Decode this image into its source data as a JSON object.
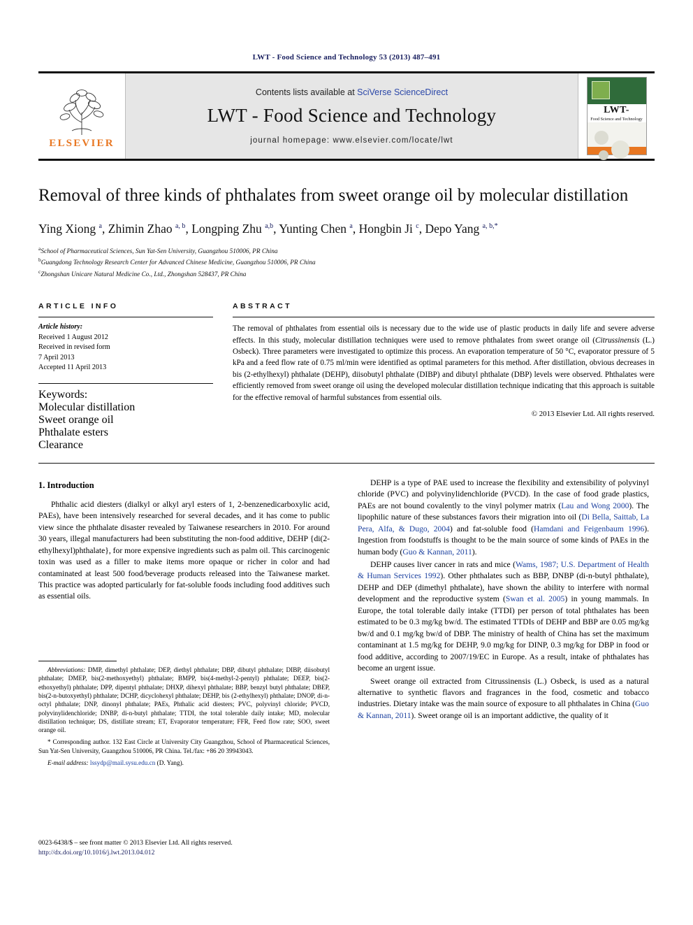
{
  "running_head": "LWT - Food Science and Technology 53 (2013) 487–491",
  "masthead": {
    "publisher_name": "ELSEVIER",
    "contents_prefix": "Contents lists available at ",
    "contents_link": "SciVerse ScienceDirect",
    "journal_name": "LWT - Food Science and Technology",
    "homepage": "journal homepage: www.elsevier.com/locate/lwt",
    "cover": {
      "title_big": "LWT-",
      "title_small": "Food Science and Technology"
    }
  },
  "article": {
    "title": "Removal of three kinds of phthalates from sweet orange oil by molecular distillation",
    "authors_html": "Ying Xiong <sup>a</sup>, Zhimin Zhao <sup>a, b</sup>, Longping Zhu <sup>a,b</sup>, Yunting Chen <sup>a</sup>, Hongbin Ji <sup>c</sup>, Depo Yang <sup>a, b,<span style=\"font-style:normal\">*</span></sup>",
    "affiliations": [
      "School of Pharmaceutical Sciences, Sun Yat-Sen University, Guangzhou 510006, PR China",
      "Guangdong Technology Research Center for Advanced Chinese Medicine, Guangzhou 510006, PR China",
      "Zhongshan Unicare Natural Medicine Co., Ltd., Zhongshan 528437, PR China"
    ],
    "affiliation_marks": [
      "a",
      "b",
      "c"
    ]
  },
  "article_info": {
    "heading": "ARTICLE INFO",
    "history_label": "Article history:",
    "history": [
      "Received 1 August 2012",
      "Received in revised form",
      "7 April 2013",
      "Accepted 11 April 2013"
    ],
    "keywords_label": "Keywords:",
    "keywords": [
      "Molecular distillation",
      "Sweet orange oil",
      "Phthalate esters",
      "Clearance"
    ]
  },
  "abstract": {
    "heading": "ABSTRACT",
    "text_part1": "The removal of phthalates from essential oils is necessary due to the wide use of plastic products in daily life and severe adverse effects. In this study, molecular distillation techniques were used to remove phthalates from sweet orange oil (",
    "species": "Citrussinensis",
    "text_part2": " (L.) Osbeck). Three parameters were investigated to optimize this process. An evaporation temperature of 50 °C, evaporator pressure of 5 kPa and a feed flow rate of 0.75 ml/min were identified as optimal parameters for this method. After distillation, obvious decreases in bis (2-ethylhexyl) phthalate (DEHP), diisobutyl phthalate (DIBP) and dibutyl phthalate (DBP) levels were observed. Phthalates were efficiently removed from sweet orange oil using the developed molecular distillation technique indicating that this approach is suitable for the effective removal of harmful substances from essential oils.",
    "copyright": "© 2013 Elsevier Ltd. All rights reserved."
  },
  "introduction": {
    "heading": "1.  Introduction",
    "p1": "Phthalic acid diesters (dialkyl or alkyl aryl esters of 1, 2-benzenedicarboxylic acid, PAEs), have been intensively researched for several decades, and it has come to public view since the phthalate disaster revealed by Taiwanese researchers in 2010. For around 30 years, illegal manufacturers had been substituting the non-food additive, DEHP {di(2-ethylhexyl)phthalate}, for more expensive ingredients such as palm oil. This carcinogenic toxin was used as a filler to make items more opaque or richer in color and had contaminated at least 500 food/beverage products released into the Taiwanese market. This practice was adopted particularly for fat-soluble foods including food additives such as essential oils."
  },
  "right_column": {
    "p1_a": "DEHP is a type of PAE used to increase the flexibility and extensibility of polyvinyl chloride (PVC) and polyvinylidenchloride (PVCD). In the case of food grade plastics, PAEs are not bound covalently to the vinyl polymer matrix (",
    "p1_cite1": "Lau and Wong 2000",
    "p1_b": "). The lipophilic nature of these substances favors their migration into oil (",
    "p1_cite2": "Di Bella, Saittab, La Pera, Alfa, & Dugo, 2004",
    "p1_c": ") and fat-soluble food (",
    "p1_cite3": "Hamdani and Feigenbaum 1996",
    "p1_d": "). Ingestion from foodstuffs is thought to be the main source of some kinds of PAEs in the human body (",
    "p1_cite4": "Guo & Kannan, 2011",
    "p1_e": ").",
    "p2_a": "DEHP causes liver cancer in rats and mice (",
    "p2_cite1": "Wams, 1987; U.S. Department of Health & Human Services 1992",
    "p2_b": "). Other phthalates such as BBP, DNBP (di-n-butyl phthalate), DEHP and DEP (dimethyl phthalate), have shown the ability to interfere with normal development and the reproductive system (",
    "p2_cite2": "Swan et al. 2005",
    "p2_c": ") in young mammals. In Europe, the total tolerable daily intake (TTDI) per person of total phthalates has been estimated to be 0.3 mg/kg bw/d. The estimated TTDIs of DEHP and BBP are 0.05 mg/kg bw/d and 0.1 mg/kg bw/d of DBP. The ministry of health of China has set the maximum contaminant at 1.5 mg/kg for DEHP, 9.0 mg/kg for DINP, 0.3 mg/kg for DBP in food or food additive, according to 2007/19/EC in Europe. As a result, intake of phthalates has become an urgent issue.",
    "p3_a": "Sweet orange oil extracted from ",
    "p3_species": "Citrussinensis",
    "p3_b": " (L.) Osbeck, is used as a natural alternative to synthetic flavors and fragrances in the food, cosmetic and tobacco industries. Dietary intake was the main source of exposure to all phthalates in China (",
    "p3_cite1": "Guo & Kannan, 2011",
    "p3_c": "). Sweet orange oil is an important addictive, the quality of it"
  },
  "footnotes": {
    "abbreviations_label": "Abbreviations:",
    "abbreviations_text": " DMP, dimethyl phthalate; DEP, diethyl phthalate; DBP, dibutyl phthalate; DIBP, diisobutyl phthalate; DMEP, bis(2-methoxyethyl) phthalate; BMPP, bis(4-methyl-2-pentyl) phthalate; DEEP, bis(2-ethoxyethyl) phthalate; DPP, dipentyl phthalate; DHXP, dihexyl phthalate; BBP, benzyl butyl phthalate; DBEP, bis(2-n-butoxyethyl) phthalate; DCHP, dicyclohexyl phthalate; DEHP, bis (2-ethylhexyl) phthalate; DNOP, di-n-octyl phthalate; DNP, dinonyl phthalate; PAEs, Phthalic acid diesters; PVC, polyvinyl chloride; PVCD, polyvinylidenchloride; DNBP, di-n-butyl phthalate; TTDI, the total tolerable daily intake; MD, molecular distillation technique; DS, distillate stream; ET, Evaporator temperature; FFR, Feed flow rate; SOO, sweet orange oil.",
    "corresponding_mark": "*",
    "corresponding_text": " Corresponding author. 132 East Circle at University City Guangzhou, School of Pharmaceutical Sciences, Sun Yat-Sen University, Guangzhou 510006, PR China. Tel./fax: +86 20 39943043.",
    "email_label": "E-mail address:",
    "email": "lssydp@mail.sysu.edu.cn",
    "email_suffix": " (D. Yang)."
  },
  "page_footer": {
    "line1": "0023-6438/$ – see front matter © 2013 Elsevier Ltd. All rights reserved.",
    "doi": "http://dx.doi.org/10.1016/j.lwt.2013.04.012"
  },
  "colors": {
    "link": "#2b47a8",
    "citation": "#1a3f9e",
    "elsevier_orange": "#E87722",
    "running_head": "#1a2060"
  }
}
